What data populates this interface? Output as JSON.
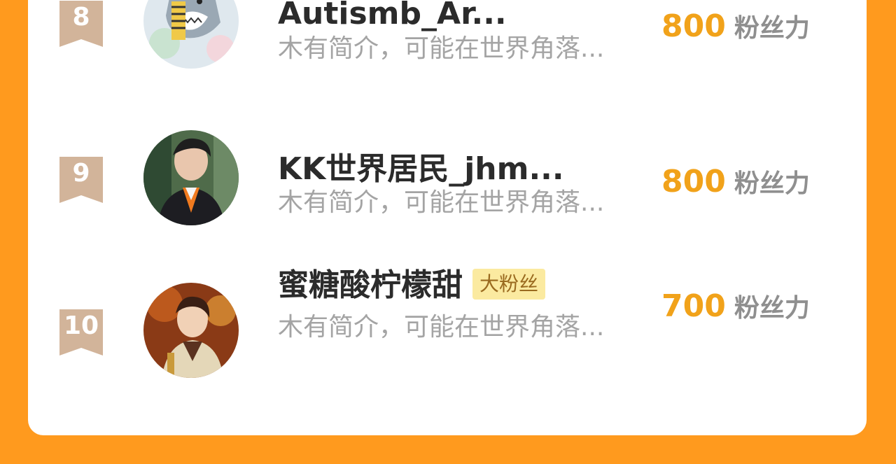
{
  "colors": {
    "background": "#FF9A1E",
    "panel": "#ffffff",
    "badge": "#D2B49A",
    "score": "#F1A21A",
    "name": "#2b2b2b",
    "bio": "#a4a4a4",
    "tag_bg": "#FBEAA0"
  },
  "rows": [
    {
      "rank": "8",
      "name": "Autismb_Ar...",
      "bio": "木有简介，可能在世界角落...",
      "score": "800",
      "score_unit": "粉丝力",
      "avatar": "cartoon-shark-avatar"
    },
    {
      "rank": "9",
      "name": "KK世界居民_jhm...",
      "bio": "木有简介，可能在世界角落...",
      "score": "800",
      "score_unit": "粉丝力",
      "avatar": "man-portrait-avatar"
    },
    {
      "rank": "10",
      "name": "蜜糖酸柠檬甜",
      "tag": "大粉丝",
      "bio": "木有简介，可能在世界角落...",
      "score": "700",
      "score_unit": "粉丝力",
      "avatar": "anime-character-avatar"
    }
  ]
}
